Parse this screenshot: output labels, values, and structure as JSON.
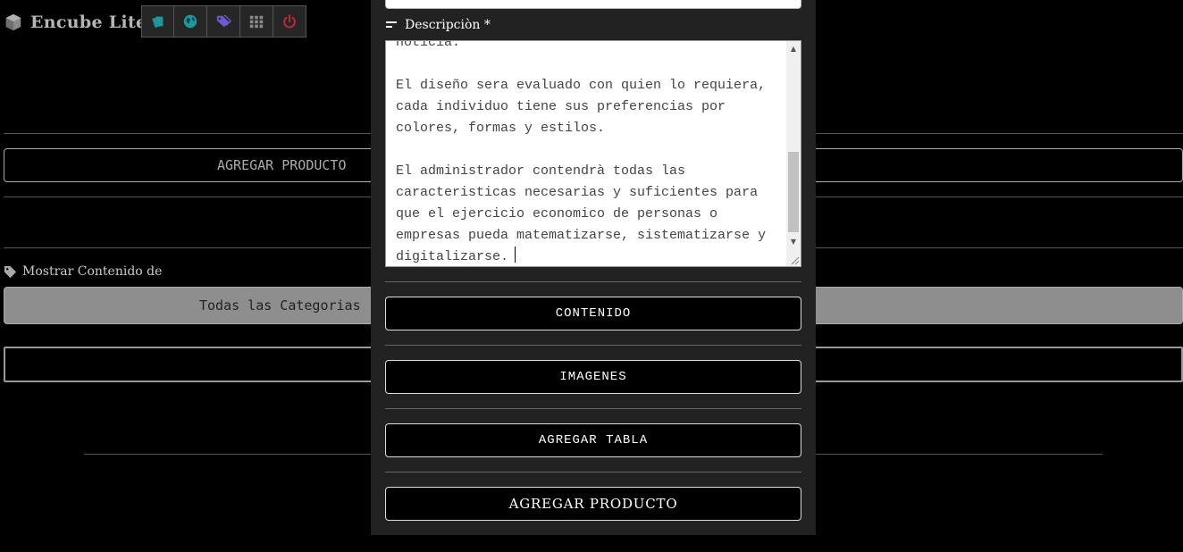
{
  "app": {
    "title": "Encube Lite",
    "brand_icon": "cube-icon"
  },
  "toolbar": {
    "buttons": [
      {
        "icon": "cards-icon",
        "color": "#1f8f8f"
      },
      {
        "icon": "globe-icon",
        "color": "#1a9aa0"
      },
      {
        "icon": "tags-icon",
        "color": "#6a5acd"
      },
      {
        "icon": "grid-icon",
        "color": "#8a8a8a"
      },
      {
        "icon": "power-icon",
        "color": "#c0283a"
      }
    ]
  },
  "background": {
    "add_product_button": "AGREGAR PRODUCTO",
    "filter_label": "Mostrar Contenido de",
    "category_select": "Todas las Categorias"
  },
  "modal": {
    "description_label": "Descripciòn *",
    "description_text": "noticia.\n\nEl diseño sera evaluado con quien lo requiera, cada individuo tiene sus preferencias por colores, formas y estilos.\n\nEl administrador contendrà todas las caracteristicas necesarias y suficientes para que el ejercicio economico de personas o empresas pueda matematizarse, sistematizarse y digitalizarse.",
    "buttons": {
      "content": "CONTENIDO",
      "images": "IMAGENES",
      "add_table": "AGREGAR TABLA",
      "add_product": "AGREGAR PRODUCTO"
    }
  }
}
